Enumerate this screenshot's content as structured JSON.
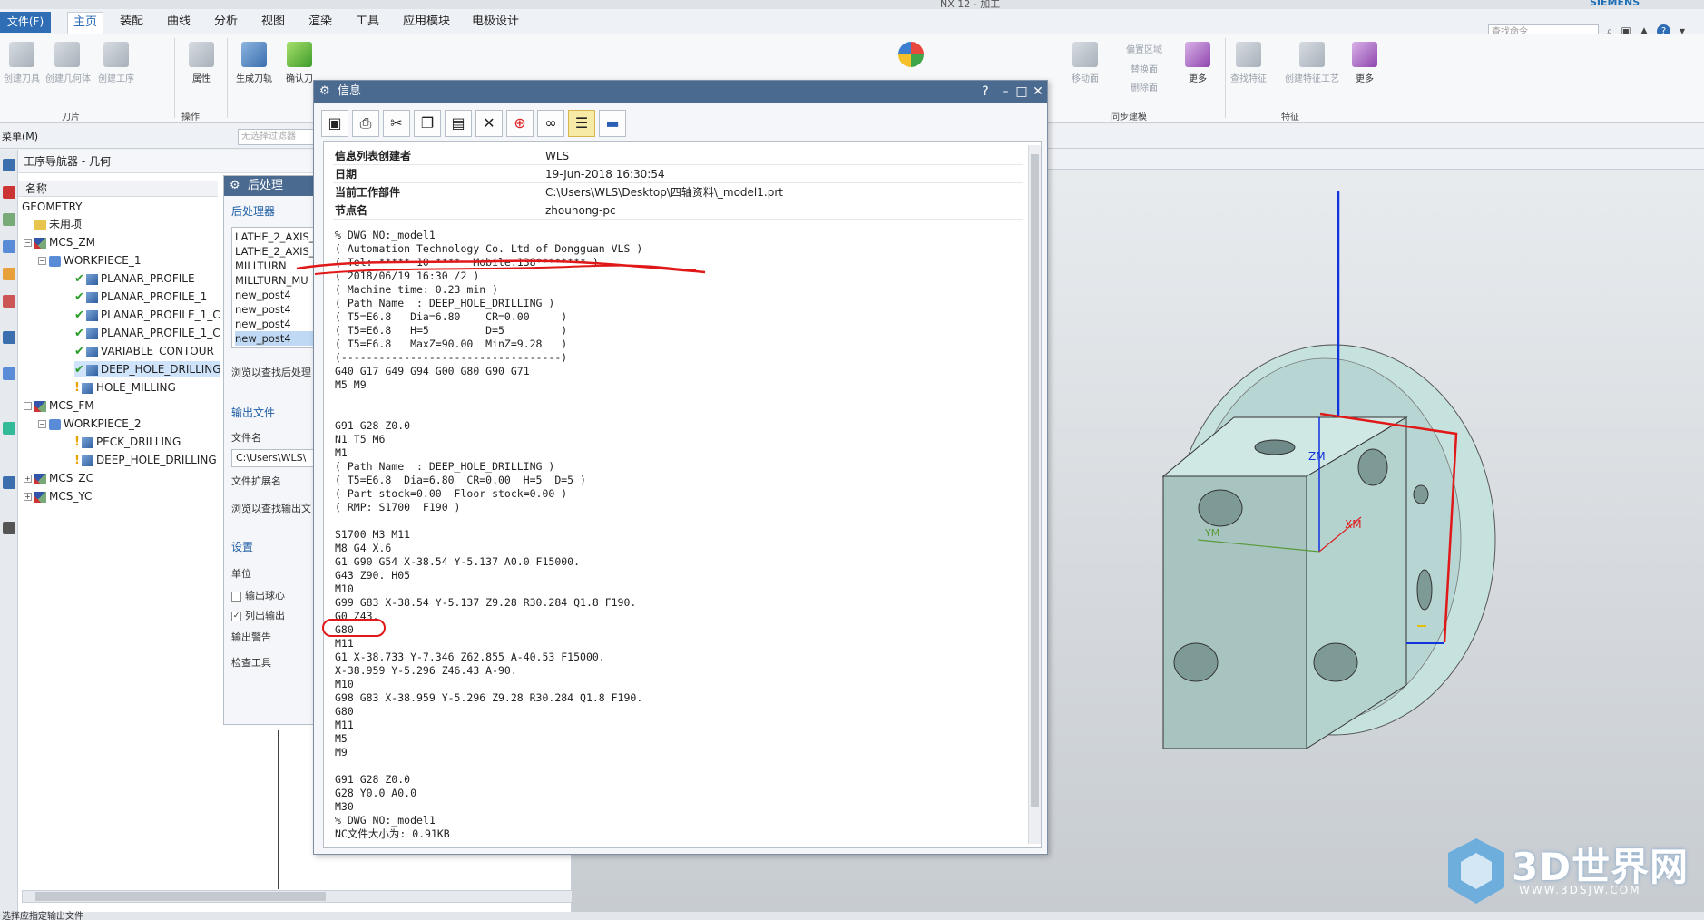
{
  "window": {
    "title": "NX 12 - 加工",
    "brand": "SIEMENS"
  },
  "menubar": {
    "file_label": "文件(F)",
    "tabs": [
      "主页",
      "装配",
      "曲线",
      "分析",
      "视图",
      "渲染",
      "工具",
      "应用模块",
      "电极设计"
    ],
    "active_tab": "主页",
    "search_placeholder": "查找命令"
  },
  "ribbon": {
    "buttons": [
      {
        "label": "创建刀具",
        "icon": "create-tool-icon"
      },
      {
        "label": "创建几何体",
        "icon": "create-geometry-icon"
      },
      {
        "label": "创建工序",
        "icon": "create-operation-icon"
      },
      {
        "label": "属性",
        "icon": "properties-icon"
      },
      {
        "label": "生成刀轨",
        "icon": "generate-toolpath-icon"
      },
      {
        "label": "确认刀",
        "icon": "verify-toolpath-icon"
      },
      {
        "label": "移动面",
        "icon": "move-face-icon"
      },
      {
        "label": "偏置区域",
        "icon": "offset-region-icon"
      },
      {
        "label": "替换面",
        "icon": "replace-face-icon"
      },
      {
        "label": "删除面",
        "icon": "delete-face-icon"
      },
      {
        "label": "更多",
        "icon": "more-icon"
      },
      {
        "label": "查找特征",
        "icon": "find-feature-icon"
      },
      {
        "label": "创建特征工艺",
        "icon": "create-feature-process-icon"
      },
      {
        "label": "更多",
        "icon": "more-icon"
      }
    ],
    "groups": [
      "刀片",
      "操作",
      "同步建模",
      "特征"
    ]
  },
  "subbar": {
    "menu_label": "菜单(M)",
    "filter_placeholder": "无选择过滤器"
  },
  "navigator": {
    "title": "工序导航器 - 几何",
    "column": "名称",
    "rows": [
      {
        "label": "GEOMETRY",
        "indent": 0,
        "mark": ""
      },
      {
        "label": "未用项",
        "indent": 1,
        "mark": ""
      },
      {
        "label": "MCS_ZM",
        "indent": 1,
        "mark": ""
      },
      {
        "label": "WORKPIECE_1",
        "indent": 2,
        "mark": ""
      },
      {
        "label": "PLANAR_PROFILE",
        "indent": 3,
        "mark": "check"
      },
      {
        "label": "PLANAR_PROFILE_1",
        "indent": 3,
        "mark": "check"
      },
      {
        "label": "PLANAR_PROFILE_1_C",
        "indent": 3,
        "mark": "check"
      },
      {
        "label": "PLANAR_PROFILE_1_C",
        "indent": 3,
        "mark": "check"
      },
      {
        "label": "VARIABLE_CONTOUR",
        "indent": 3,
        "mark": "check"
      },
      {
        "label": "DEEP_HOLE_DRILLING",
        "indent": 3,
        "mark": "check"
      },
      {
        "label": "HOLE_MILLING",
        "indent": 3,
        "mark": ""
      },
      {
        "label": "MCS_FM",
        "indent": 1,
        "mark": ""
      },
      {
        "label": "WORKPIECE_2",
        "indent": 2,
        "mark": ""
      },
      {
        "label": "PECK_DRILLING",
        "indent": 3,
        "mark": "warn"
      },
      {
        "label": "DEEP_HOLE_DRILLING",
        "indent": 3,
        "mark": "warn"
      },
      {
        "label": "MCS_ZC",
        "indent": 1,
        "mark": ""
      },
      {
        "label": "MCS_YC",
        "indent": 1,
        "mark": ""
      }
    ]
  },
  "postprocess": {
    "title": "后处理",
    "section_post": "后处理器",
    "posts": [
      "LATHE_2_AXIS_",
      "LATHE_2_AXIS_",
      "MILLTURN",
      "MILLTURN_MU",
      "new_post4",
      "new_post4",
      "new_post4",
      "new_post4"
    ],
    "selected_index": 7,
    "browse_post": "浏览以查找后处理",
    "section_output": "输出文件",
    "file_name_label": "文件名",
    "file_name_value": "C:\\Users\\WLS\\",
    "file_ext_label": "文件扩展名",
    "browse_output": "浏览以查找输出文",
    "section_settings": "设置",
    "units_label": "单位",
    "output_ball": "输出球心",
    "list_output": "列出输出",
    "output_warning": "输出警告",
    "check_tool": "检查工具"
  },
  "info": {
    "title": "信息",
    "fields": [
      {
        "key": "信息列表创建者",
        "value": "WLS"
      },
      {
        "key": "日期",
        "value": "19-Jun-2018 16:30:54"
      },
      {
        "key": "当前工作部件",
        "value": "C:\\Users\\WLS\\Desktop\\四轴资料\\_model1.prt"
      },
      {
        "key": "节点名",
        "value": "zhouhong-pc"
      }
    ],
    "code": [
      "% DWG NO:_model1",
      "( Automation Technology Co. Ltd of Dongguan VLS )",
      "( Tel: ***** 10 ****  Mobile:138******** )",
      "( 2018/06/19 16:30 /2 )",
      "( Machine time: 0.23 min )",
      "( Path Name  : DEEP_HOLE_DRILLING )",
      "( T5=E6.8   Dia=6.80    CR=0.00     )",
      "( T5=E6.8   H=5         D=5         )",
      "( T5=E6.8   MaxZ=90.00  MinZ=9.28   )",
      "(-----------------------------------)",
      "G40 G17 G49 G94 G00 G80 G90 G71",
      "M5 M9",
      "",
      "",
      "G91 G28 Z0.0",
      "N1 T5 M6",
      "M1",
      "( Path Name  : DEEP_HOLE_DRILLING )",
      "( T5=E6.8  Dia=6.80  CR=0.00  H=5  D=5 )",
      "( Part stock=0.00  Floor stock=0.00 )",
      "( RMP: S1700  F190 )",
      "",
      "S1700 M3 M11",
      "M8 G4 X.6",
      "G1 G90 G54 X-38.54 Y-5.137 A0.0 F15000.",
      "G43 Z90. H05",
      "M10",
      "G99 G83 X-38.54 Y-5.137 Z9.28 R30.284 Q1.8 F190.",
      "G0 Z43.",
      "G80",
      "M11",
      "G1 X-38.733 Y-7.346 Z62.855 A-40.53 F15000.",
      "X-38.959 Y-5.296 Z46.43 A-90.",
      "M10",
      "G98 G83 X-38.959 Y-5.296 Z9.28 R30.284 Q1.8 F190.",
      "G80",
      "M11",
      "M5",
      "M9",
      "",
      "G91 G28 Z0.0",
      "G28 Y0.0 A0.0",
      "M30",
      "% DWG NO:_model1",
      "NC文件大小为: 0.91KB"
    ]
  },
  "viewport": {
    "axis_labels": [
      "ZM",
      "XM",
      "YM"
    ]
  },
  "watermark": {
    "text": "3D世界网",
    "url": "WWW.3DSJW.COM"
  },
  "status": {
    "text": "选择应指定输出文件"
  }
}
